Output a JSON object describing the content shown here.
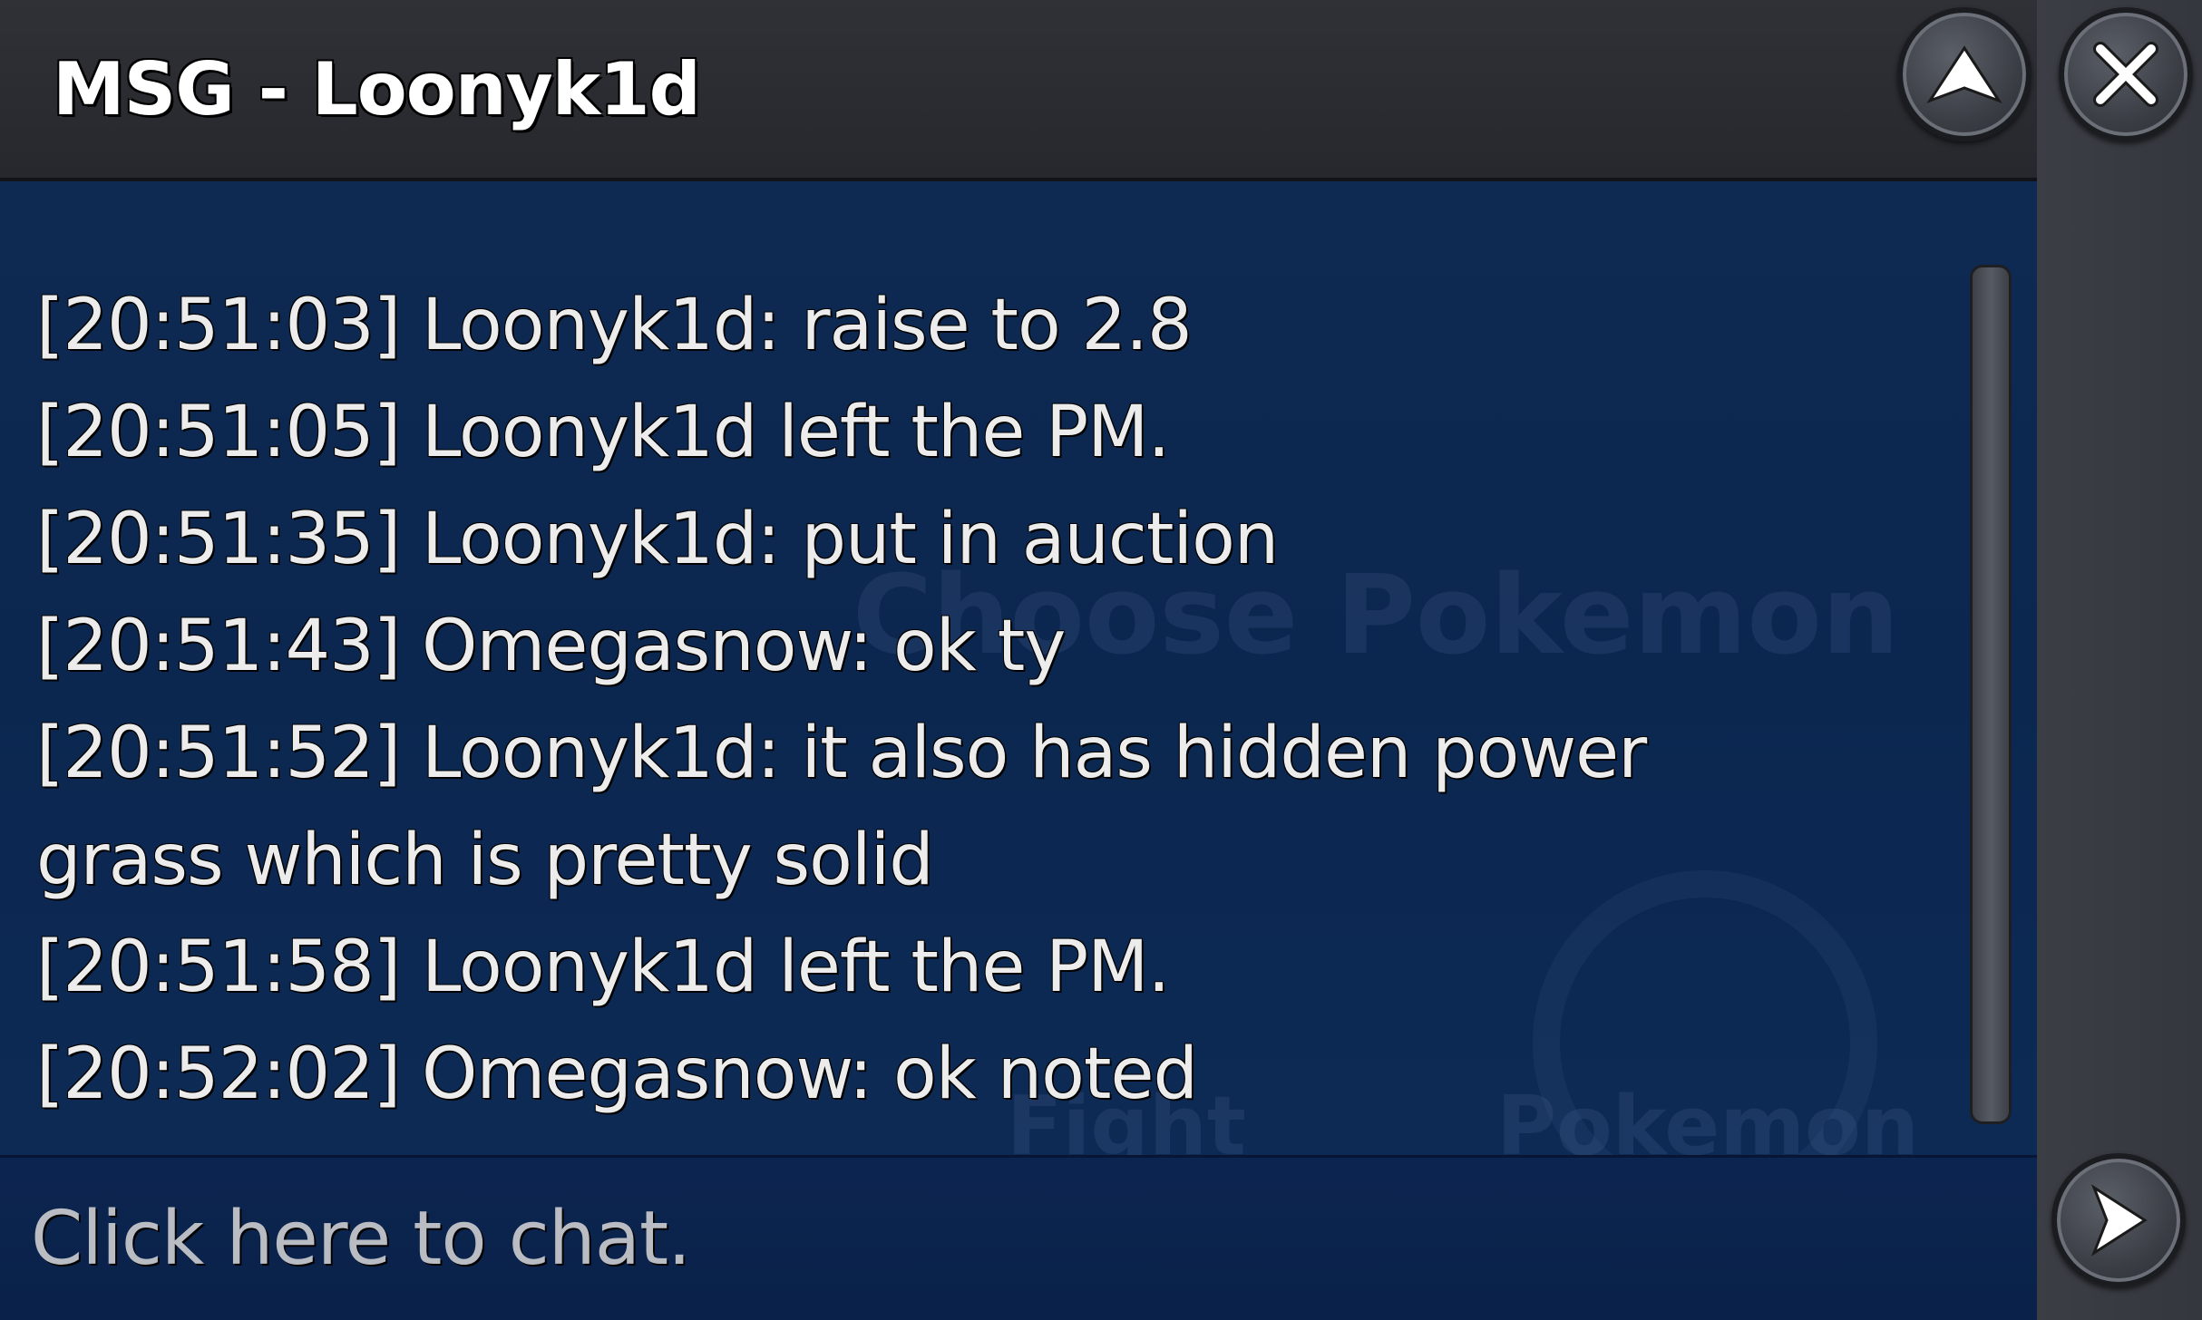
{
  "window": {
    "title": "MSG - Loonyk1d"
  },
  "background_hint": {
    "choose": "Choose Pokemon",
    "fight": "Fight",
    "pokemon": "Pokemon"
  },
  "messages": [
    {
      "text": "[20:51:03] Loonyk1d: raise to 2.8"
    },
    {
      "text": "[20:51:05] Loonyk1d left the PM."
    },
    {
      "text": "[20:51:35] Loonyk1d: put in auction"
    },
    {
      "text": "[20:51:43] Omegasnow: ok ty"
    },
    {
      "text": "[20:51:52] Loonyk1d: it also has hidden power\ngrass which is pretty solid"
    },
    {
      "text": "[20:51:58] Loonyk1d left the PM."
    },
    {
      "text": "[20:52:02] Omegasnow: ok noted"
    }
  ],
  "input": {
    "placeholder": "Click here to chat."
  },
  "icons": {
    "minimize": "triangle-up-icon",
    "close": "close-x-icon",
    "send": "triangle-right-icon"
  },
  "colors": {
    "chat_background": "#0b2750",
    "text": "#ececec",
    "frame": "#2f3137"
  }
}
